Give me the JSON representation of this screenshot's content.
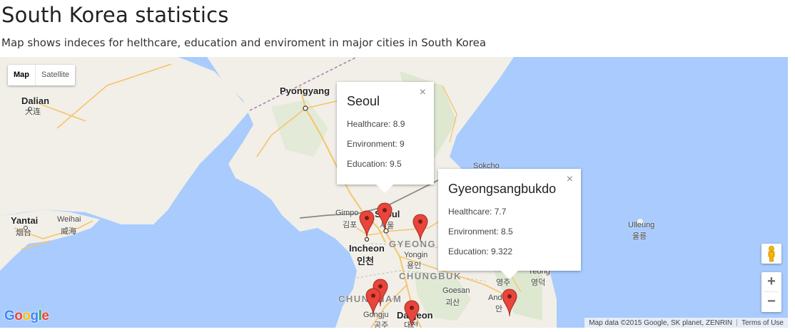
{
  "page": {
    "title": "South Korea statistics",
    "subtitle": "Map shows indeces for helthcare, education and enviroment in major cities in South Korea"
  },
  "map_type": {
    "map_label": "Map",
    "satellite_label": "Satellite",
    "selected": "Map"
  },
  "map_labels": {
    "dalian": "Dalian",
    "dalian_cn": "大连",
    "pyongyang": "Pyongyang",
    "yantai": "Yantai",
    "yantai_cn": "烟台",
    "weihai": "Weihai",
    "weihai_cn": "威海",
    "gimpo": "Gimpo",
    "gimpo_ko": "김포",
    "seoul": "Seoul",
    "seoul_ko": "서울",
    "incheon": "Incheon",
    "incheon_ko": "인천",
    "yongin": "Yongin",
    "yongin_ko": "용인",
    "gyeonggi_region": "GYEONG",
    "chungbuk_region": "CHUNGBUK",
    "chungnam_region": "CHUNGNAM",
    "sokcho": "Sokcho",
    "ulleung": "Ulleung",
    "ulleung_ko": "울릉",
    "yeongju": "영주",
    "goesan": "Goesan",
    "goesan_ko": "괴산",
    "andong": "And",
    "andong_ko": "안",
    "gongju": "Gongju",
    "gongju_ko": "공주",
    "daejeon": "Daejeon",
    "daejeon_ko": "대전",
    "tokb": "Yeong",
    "tokb_ko": "영덕"
  },
  "infowindows": [
    {
      "title": "Seoul",
      "healthcare": "Healthcare: 8.9",
      "environment": "Environment: 9",
      "education": "Education: 9.5",
      "close": "×"
    },
    {
      "title": "Gyeongsangbukdo",
      "healthcare": "Healthcare: 7.7",
      "environment": "Environment: 8.5",
      "education": "Education: 9.322",
      "close": "×"
    }
  ],
  "controls": {
    "zoom_in": "+",
    "zoom_out": "−"
  },
  "attribution": {
    "map_data": "Map data ©2015 Google, SK planet, ZENRIN",
    "terms": "Terms of Use"
  },
  "logo": {
    "g1": "G",
    "o1": "o",
    "o2": "o",
    "g2": "g",
    "l": "l",
    "e": "e"
  },
  "colors": {
    "sea": "#a9cbfd",
    "land": "#f1efe8",
    "marker": "#e8453c",
    "road": "#f7c46b"
  },
  "icons": {
    "marker": "map-marker-icon",
    "pegman": "pegman-icon",
    "close": "close-icon"
  }
}
